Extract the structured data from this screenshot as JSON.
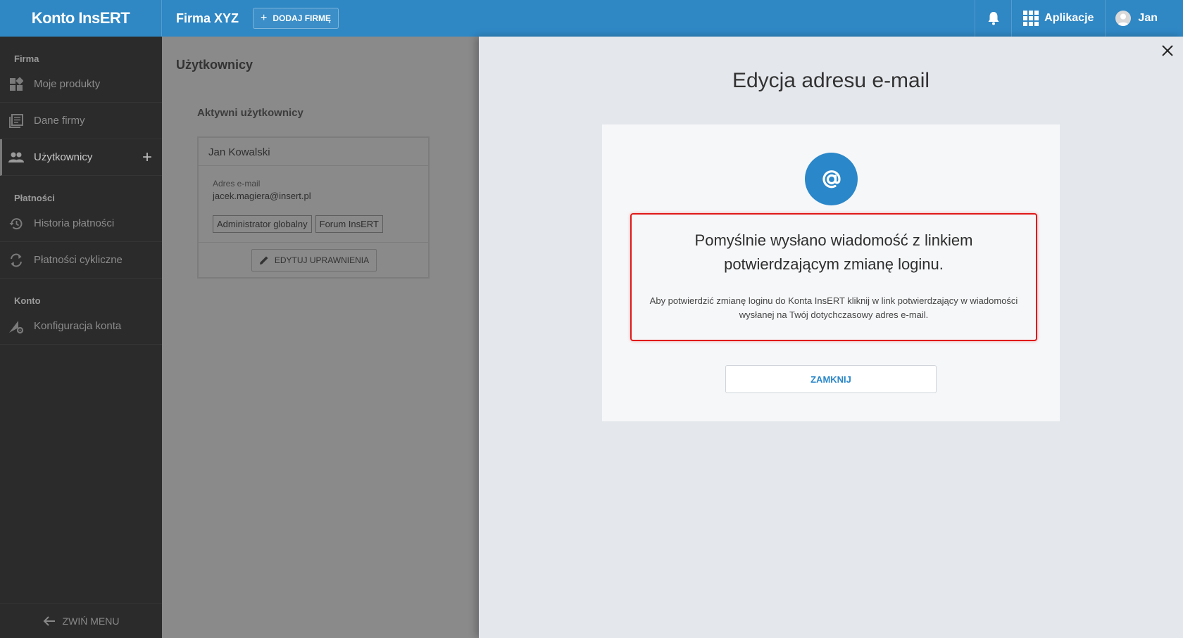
{
  "topbar": {
    "brand": "Konto InsERT",
    "company": "Firma XYZ",
    "add_company": "DODAJ FIRMĘ",
    "apps_label": "Aplikacje",
    "user_name": "Jan",
    "accent_color": "#2f87c4"
  },
  "sidebar": {
    "sections": [
      {
        "title": "Firma",
        "items": [
          {
            "label": "Moje produkty",
            "icon": "dashboard-icon"
          },
          {
            "label": "Dane firmy",
            "icon": "document-icon"
          },
          {
            "label": "Użytkownicy",
            "icon": "users-icon",
            "active": true
          }
        ]
      },
      {
        "title": "Płatności",
        "items": [
          {
            "label": "Historia płatności",
            "icon": "history-icon"
          },
          {
            "label": "Płatności cykliczne",
            "icon": "recurring-icon"
          }
        ]
      },
      {
        "title": "Konto",
        "items": [
          {
            "label": "Konfiguracja konta",
            "icon": "account-settings-icon"
          }
        ]
      }
    ],
    "collapse_label": "ZWIŃ MENU"
  },
  "main": {
    "title": "Użytkownicy",
    "subtitle": "Aktywni użytkownicy",
    "user_card": {
      "name": "Jan Kowalski",
      "email_label": "Adres e-mail",
      "email": "jacek.magiera@insert.pl",
      "roles": [
        "Administrator globalny",
        "Forum InsERT"
      ],
      "edit_label": "EDYTUJ UPRAWNIENIA"
    }
  },
  "panel": {
    "title": "Edycja adresu e-mail",
    "message_title": "Pomyślnie wysłano wiadomość z linkiem potwierdzającym zmianę loginu.",
    "message_body": "Aby potwierdzić zmianę loginu do Konta InsERT kliknij w link potwierdzający w wiadomości wysłanej na Twój dotychczasowy adres e-mail.",
    "close_label": "ZAMKNIJ",
    "highlight_color": "#e01818"
  }
}
